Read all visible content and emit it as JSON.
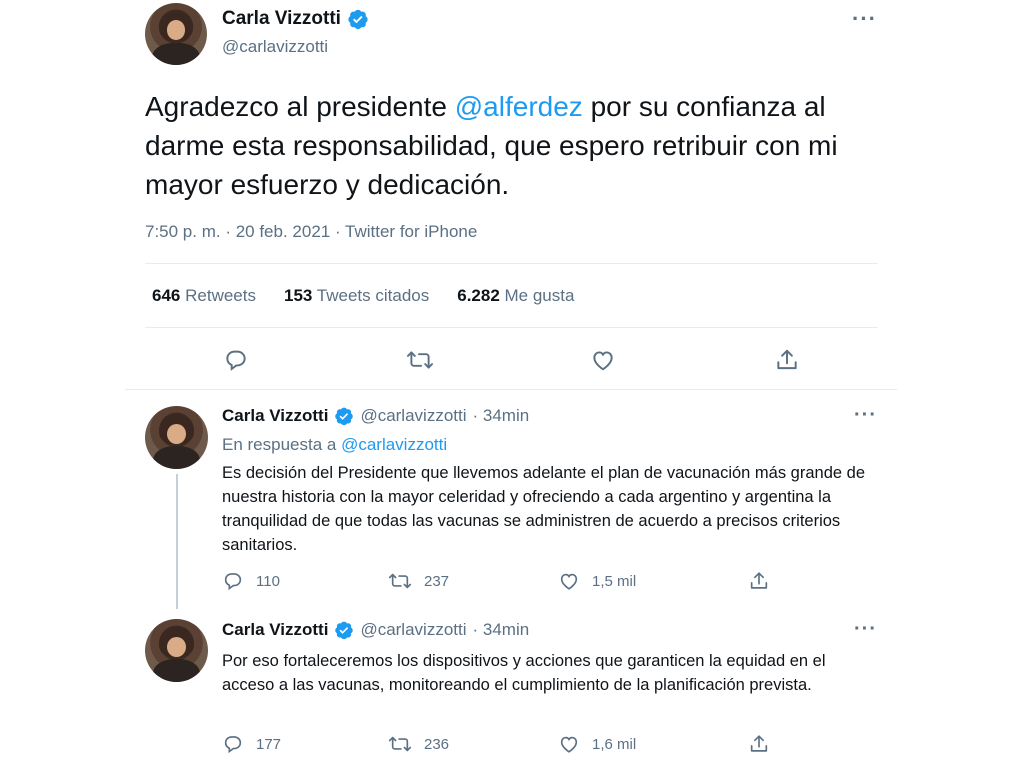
{
  "main_tweet": {
    "author_name": "Carla Vizzotti",
    "handle": "@carlavizzotti",
    "text_before": "Agradezco al presidente ",
    "mention": "@alferdez",
    "text_after": " por su confianza al darme esta responsabilidad, que espero retribuir con mi mayor esfuerzo y dedicación.",
    "timestamp": "7:50 p. m. · 20 feb. 2021 · Twitter for iPhone",
    "stats": {
      "retweets_count": "646",
      "retweets_label": "Retweets",
      "quotes_count": "153",
      "quotes_label": "Tweets citados",
      "likes_count": "6.282",
      "likes_label": "Me gusta"
    }
  },
  "replies": [
    {
      "author_name": "Carla Vizzotti",
      "handle": "@carlavizzotti",
      "time": "· 34min",
      "reply_to_prefix": "En respuesta a ",
      "reply_to_handle": "@carlavizzotti",
      "text": "Es decisión del Presidente que llevemos adelante el plan de vacunación más grande de nuestra historia con la mayor celeridad y ofreciendo a cada argentino y argentina la tranquilidad de que todas las vacunas se administren de acuerdo a precisos criterios sanitarios.",
      "reply_count": "110",
      "retweet_count": "237",
      "like_count": "1,5 mil"
    },
    {
      "author_name": "Carla Vizzotti",
      "handle": "@carlavizzotti",
      "time": "· 34min",
      "text": "Por eso fortaleceremos los dispositivos y acciones que garanticen la equidad en el acceso a las vacunas,  monitoreando el  cumplimiento de la planificación prevista.",
      "reply_count": "177",
      "retweet_count": "236",
      "like_count": "1,6 mil"
    }
  ],
  "icons": {
    "verified": "verified-badge-icon",
    "more": "more-icon",
    "reply": "reply-icon",
    "retweet": "retweet-icon",
    "like": "like-icon",
    "share": "share-icon"
  },
  "colors": {
    "accent": "#1d9bf0",
    "secondary_text": "#5b7083",
    "divider": "#e6ecf0"
  }
}
